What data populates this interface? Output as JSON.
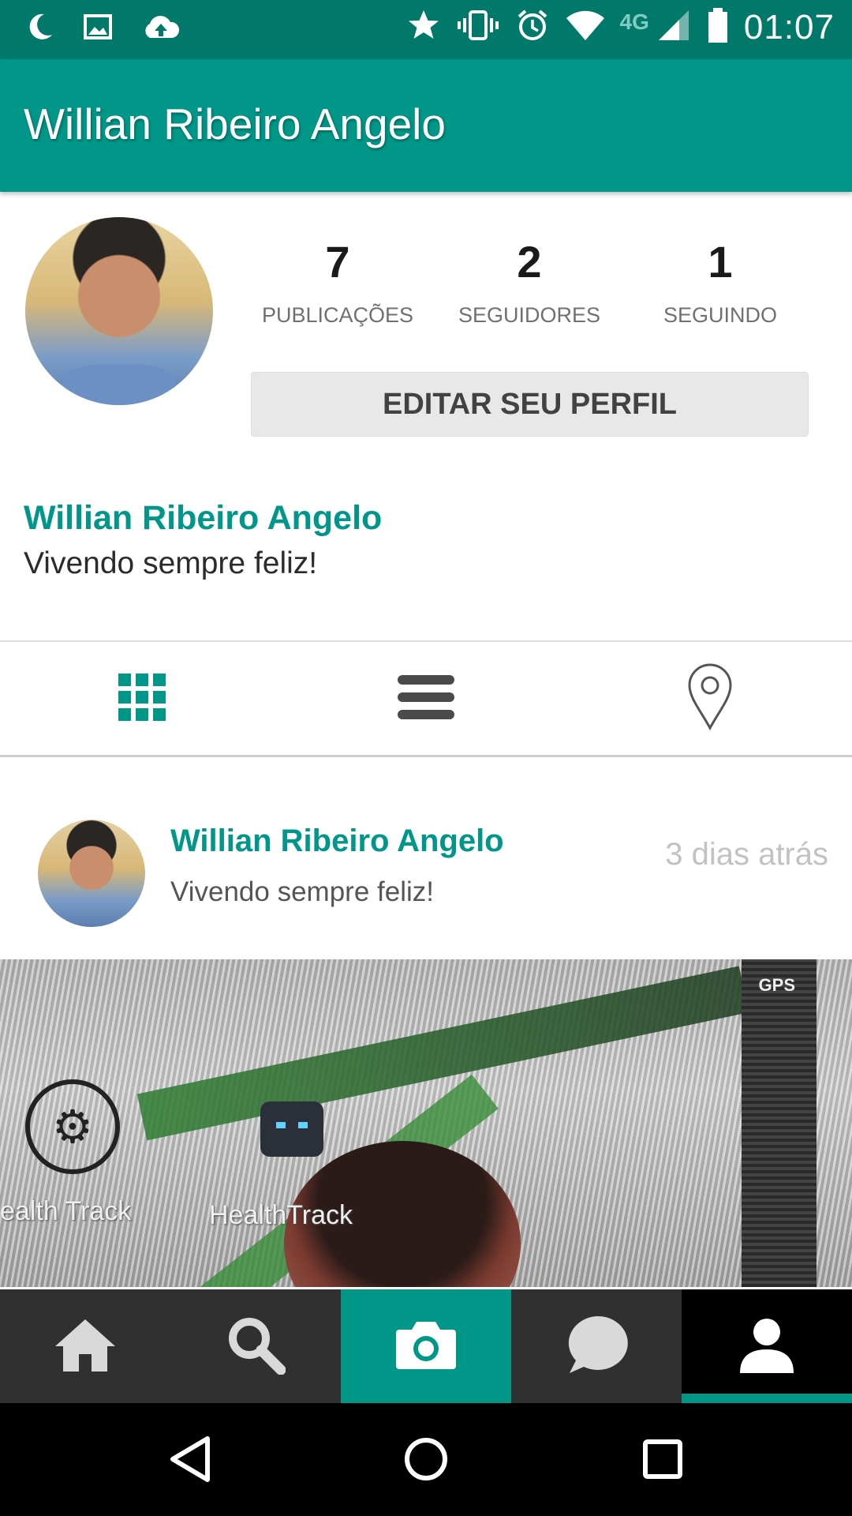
{
  "status_bar": {
    "network": "4G",
    "time": "01:07",
    "icons": [
      "moon-icon",
      "image-icon",
      "cloud-upload-icon",
      "star-icon",
      "vibrate-icon",
      "alarm-icon",
      "wifi-icon",
      "signal-icon",
      "battery-icon"
    ]
  },
  "app_bar": {
    "title": "Willian Ribeiro Angelo"
  },
  "profile": {
    "stats": [
      {
        "value": "7",
        "label": "PUBLICAÇÕES"
      },
      {
        "value": "2",
        "label": "SEGUIDORES"
      },
      {
        "value": "1",
        "label": "SEGUINDO"
      }
    ],
    "edit_button": "EDITAR SEU PERFIL",
    "name": "Willian Ribeiro Angelo",
    "bio": "Vivendo sempre feliz!"
  },
  "view_tabs": [
    {
      "name": "grid-view",
      "icon": "grid-icon",
      "active": true
    },
    {
      "name": "list-view",
      "icon": "list-icon",
      "active": false
    },
    {
      "name": "location-view",
      "icon": "location-pin-icon",
      "active": false
    }
  ],
  "post": {
    "author": "Willian Ribeiro Angelo",
    "text": "Vivendo sempre feliz!",
    "time": "3 dias atrás",
    "image_labels": {
      "left": "ealth Track",
      "right": "HealthTrack",
      "gps": "GPS"
    }
  },
  "bottom_nav": [
    {
      "name": "home",
      "icon": "home-icon"
    },
    {
      "name": "search",
      "icon": "search-icon"
    },
    {
      "name": "camera",
      "icon": "camera-icon"
    },
    {
      "name": "chat",
      "icon": "chat-bubble-icon"
    },
    {
      "name": "profile",
      "icon": "person-icon",
      "active": true
    }
  ],
  "colors": {
    "status_bar": "#00796b",
    "primary": "#009688",
    "accent_text": "#00968a",
    "nav_background": "#303030"
  }
}
